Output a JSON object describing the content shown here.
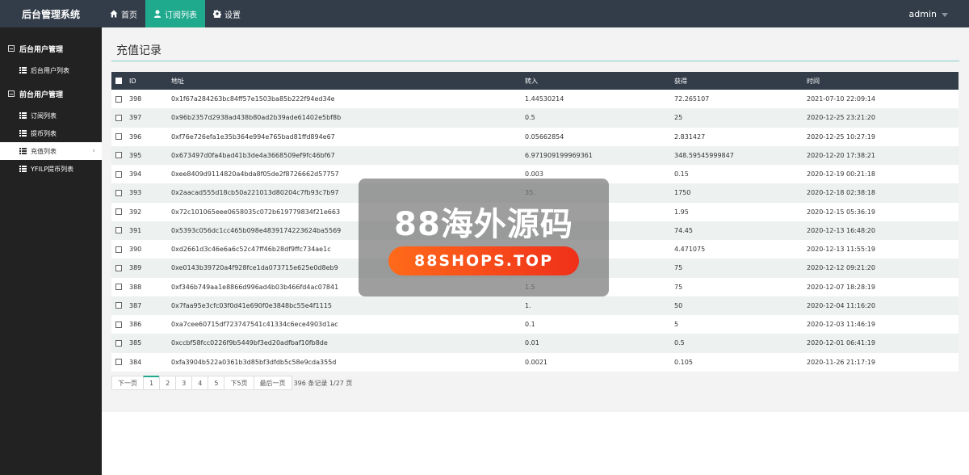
{
  "app": {
    "brand": "后台管理系统"
  },
  "topnav": {
    "items": [
      {
        "label": "首页",
        "icon": "home-icon",
        "active": false
      },
      {
        "label": "订阅列表",
        "icon": "user-icon",
        "active": true
      },
      {
        "label": "设置",
        "icon": "gear-icon",
        "active": false
      }
    ],
    "user": "admin"
  },
  "sidebar": {
    "groups": [
      {
        "label": "后台用户管理",
        "items": [
          {
            "label": "后台用户列表",
            "active": false
          }
        ]
      },
      {
        "label": "前台用户管理",
        "items": [
          {
            "label": "订阅列表",
            "active": false
          },
          {
            "label": "提币列表",
            "active": false
          },
          {
            "label": "充值列表",
            "active": true
          },
          {
            "label": "YFILP提币列表",
            "active": false
          }
        ]
      }
    ]
  },
  "page": {
    "title": "充值记录"
  },
  "table": {
    "headers": {
      "id": "ID",
      "addr": "地址",
      "in": "转入",
      "get": "获得",
      "time": "时间"
    },
    "rows": [
      {
        "id": "398",
        "addr": "0x1f67a284263bc84ff57e1503ba85b222f94ed34e",
        "in": "1.44530214",
        "get": "72.265107",
        "time": "2021-07-10 22:09:14"
      },
      {
        "id": "397",
        "addr": "0x96b2357d2938ad438b80ad2b39ade61402e5bf8b",
        "in": "0.5",
        "get": "25",
        "time": "2020-12-25 23:21:20"
      },
      {
        "id": "396",
        "addr": "0xf76e726efa1e35b364e994e765bad81ffd894e67",
        "in": "0.05662854",
        "get": "2.831427",
        "time": "2020-12-25 10:27:19"
      },
      {
        "id": "395",
        "addr": "0x673497d0fa4bad41b3de4a3668509ef9fc46bf67",
        "in": "6.971909199969361",
        "get": "348.59545999847",
        "time": "2020-12-20 17:38:21"
      },
      {
        "id": "394",
        "addr": "0xee8409d9114820a4bda8f05de2f8726662d57757",
        "in": "0.003",
        "get": "0.15",
        "time": "2020-12-19 00:21:18"
      },
      {
        "id": "393",
        "addr": "0x2aacad555d18cb50a221013d80204c7fb93c7b97",
        "in": "35.",
        "get": "1750",
        "time": "2020-12-18 02:38:18"
      },
      {
        "id": "392",
        "addr": "0x72c101065eee0658035c072b619779834f21e663",
        "in": "",
        "get": "1.95",
        "time": "2020-12-15 05:36:19"
      },
      {
        "id": "391",
        "addr": "0x5393c056dc1cc465b098e4839174223624ba5569",
        "in": "",
        "get": "74.45",
        "time": "2020-12-13 16:48:20"
      },
      {
        "id": "390",
        "addr": "0xd2661d3c46e6a6c52c47ff46b28df9ffc734ae1c",
        "in": "",
        "get": "4.471075",
        "time": "2020-12-13 11:55:19"
      },
      {
        "id": "389",
        "addr": "0xe0143b39720a4f928fce1da073715e625e0d8eb9",
        "in": "",
        "get": "75",
        "time": "2020-12-12 09:21:20"
      },
      {
        "id": "388",
        "addr": "0xf346b749aa1e8866d996ad4b03b466fd4ac07841",
        "in": "1.5",
        "get": "75",
        "time": "2020-12-07 18:28:19"
      },
      {
        "id": "387",
        "addr": "0x7faa95e3cfc03f0d41e690f0e3848bc55e4f1115",
        "in": "1.",
        "get": "50",
        "time": "2020-12-04 11:16:20"
      },
      {
        "id": "386",
        "addr": "0xa7cee60715df723747541c41334c6ece4903d1ac",
        "in": "0.1",
        "get": "5",
        "time": "2020-12-03 11:46:19"
      },
      {
        "id": "385",
        "addr": "0xccbf58fcc0226f9b5449bf3ed20adfbaf10fb8de",
        "in": "0.01",
        "get": "0.5",
        "time": "2020-12-01 06:41:19"
      },
      {
        "id": "384",
        "addr": "0xfa3904b522a0361b3d85bf3dfdb5c58e9cda355d",
        "in": "0.0021",
        "get": "0.105",
        "time": "2020-11-26 21:17:19"
      }
    ]
  },
  "pagination": {
    "prev": "下一页",
    "pages": [
      "1",
      "2",
      "3",
      "4",
      "5"
    ],
    "current": "1",
    "next5": "下5页",
    "last": "最后一页",
    "info": "396 条记录 1/27 页"
  },
  "watermark": {
    "title": "88海外源码",
    "url": "88SHOPS.TOP"
  },
  "colors": {
    "accent": "#1faa8e",
    "header": "#333d4a",
    "sidebar": "#222222",
    "watermark_pill": "#f0301a"
  }
}
